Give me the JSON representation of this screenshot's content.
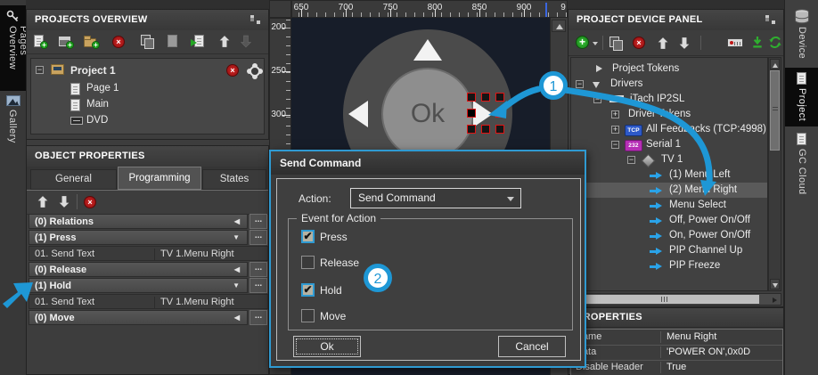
{
  "colors": {
    "accent": "#1e97d5",
    "dialog_border": "#2f9ad2",
    "delete_red": "#b31919",
    "add_green": "#23a523",
    "canvas_bg": "#171d29"
  },
  "left_tabs": {
    "pages_overview": "Pages Overview",
    "gallery": "Gallery"
  },
  "projects_overview": {
    "title": "PROJECTS OVERVIEW",
    "tree": {
      "root": "Project 1",
      "children": [
        "Page 1",
        "Main",
        "DVD"
      ]
    }
  },
  "object_properties": {
    "title": "OBJECT PROPERTIES",
    "tabs": {
      "general": "General",
      "programming": "Programming",
      "states": "States"
    },
    "active_tab": "Programming",
    "more_label": "...",
    "rows": [
      {
        "label": "(0) Relations",
        "marker": "◀"
      },
      {
        "label": "(1) Press",
        "marker": "▼"
      },
      {
        "c1": "01. Send Text",
        "c2": "TV 1.Menu Right"
      },
      {
        "label": "(0) Release",
        "marker": "◀"
      },
      {
        "label": "(1) Hold",
        "marker": "▼"
      },
      {
        "c1": "01. Send Text",
        "c2": "TV 1.Menu Right"
      },
      {
        "label": "(0) Move",
        "marker": "◀"
      }
    ]
  },
  "canvas": {
    "h_ruler": [
      "650",
      "700",
      "750",
      "800",
      "850",
      "900"
    ],
    "h_ruler_partial": "9",
    "v_ruler": [
      "200",
      "250",
      "300"
    ],
    "ok_label": "Ok"
  },
  "dialog": {
    "title": "Send Command",
    "action_label": "Action:",
    "action_value": "Send Command",
    "group_label": "Event for Action",
    "checkboxes": [
      {
        "label": "Press",
        "checked": true
      },
      {
        "label": "Release",
        "checked": false
      },
      {
        "label": "Hold",
        "checked": true
      },
      {
        "label": "Move",
        "checked": false
      }
    ],
    "ok_label": "Ok",
    "cancel_label": "Cancel"
  },
  "device_panel": {
    "title": "PROJECT DEVICE PANEL",
    "badges": {
      "tcp": "TCP",
      "serial": "232"
    },
    "tree": [
      {
        "label": "Project Tokens",
        "selected": false
      },
      {
        "label": "Drivers",
        "selected": false
      },
      {
        "label": "iTach IP2SL",
        "selected": false
      },
      {
        "label": "Driver Tokens",
        "selected": false
      },
      {
        "label": "All Feedbacks (TCP:4998)",
        "selected": false
      },
      {
        "label": "Serial 1",
        "selected": false
      },
      {
        "label": "TV 1",
        "selected": false
      },
      {
        "label": "(1) Menu Left",
        "selected": false
      },
      {
        "label": "(2) Menu Right",
        "selected": true
      },
      {
        "label": "Menu Select",
        "selected": false
      },
      {
        "label": "Off, Power On/Off",
        "selected": false
      },
      {
        "label": "On, Power On/Off",
        "selected": false
      },
      {
        "label": "PIP Channel Up",
        "selected": false
      },
      {
        "label": "PIP Freeze",
        "selected": false
      }
    ]
  },
  "properties_panel": {
    "title": "PROPERTIES",
    "rows": [
      {
        "name": "Name",
        "value": "Menu Right"
      },
      {
        "name": "Data",
        "value": "'POWER ON',0x0D"
      },
      {
        "name": "Disable Header",
        "value": "True"
      }
    ]
  },
  "right_tabs": {
    "device": "Device",
    "project": "Project",
    "gc_cloud": "GC Cloud"
  },
  "callouts": {
    "step1": "1",
    "step2": "2"
  }
}
